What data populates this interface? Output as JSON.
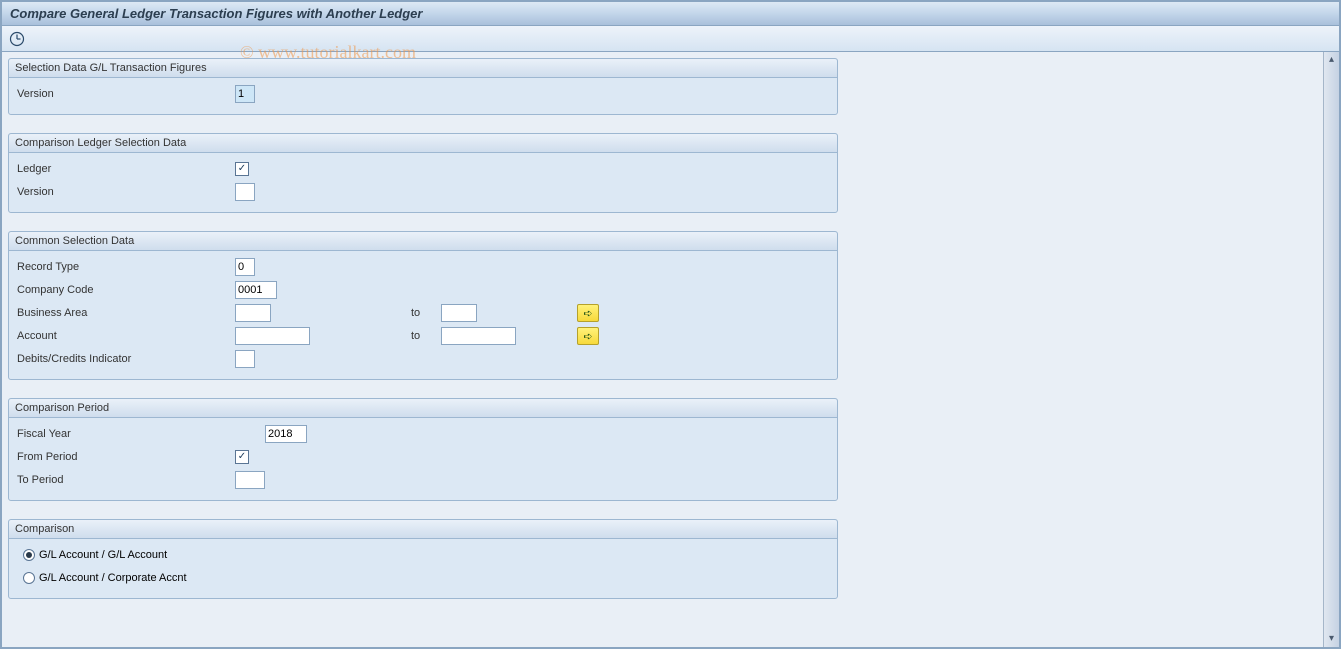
{
  "window_title": "Compare General Ledger Transaction Figures with Another Ledger",
  "watermark": "© www.tutorialkart.com",
  "groups": {
    "gl_figures": {
      "title": "Selection Data G/L Transaction Figures",
      "version_label": "Version",
      "version_value": "1"
    },
    "comp_ledger": {
      "title": "Comparison Ledger Selection Data",
      "ledger_label": "Ledger",
      "ledger_checked": true,
      "version_label": "Version",
      "version_value": ""
    },
    "common": {
      "title": "Common Selection Data",
      "record_type_label": "Record Type",
      "record_type_value": "0",
      "company_code_label": "Company Code",
      "company_code_value": "0001",
      "business_area_label": "Business Area",
      "business_area_from": "",
      "business_area_to": "",
      "account_label": "Account",
      "account_from": "",
      "account_to": "",
      "to_label": "to",
      "dc_indicator_label": "Debits/Credits Indicator",
      "dc_indicator_value": ""
    },
    "period": {
      "title": "Comparison Period",
      "fiscal_year_label": "Fiscal Year",
      "fiscal_year_value": "2018",
      "from_period_label": "From Period",
      "from_period_checked": true,
      "to_period_label": "To Period",
      "to_period_value": ""
    },
    "comparison": {
      "title": "Comparison",
      "opt1_label": "G/L Account / G/L Account",
      "opt2_label": "G/L Account / Corporate Accnt",
      "selected": "opt1"
    }
  },
  "icons": {
    "execute": "execute-clock-icon",
    "multiple_selection": "➪"
  }
}
